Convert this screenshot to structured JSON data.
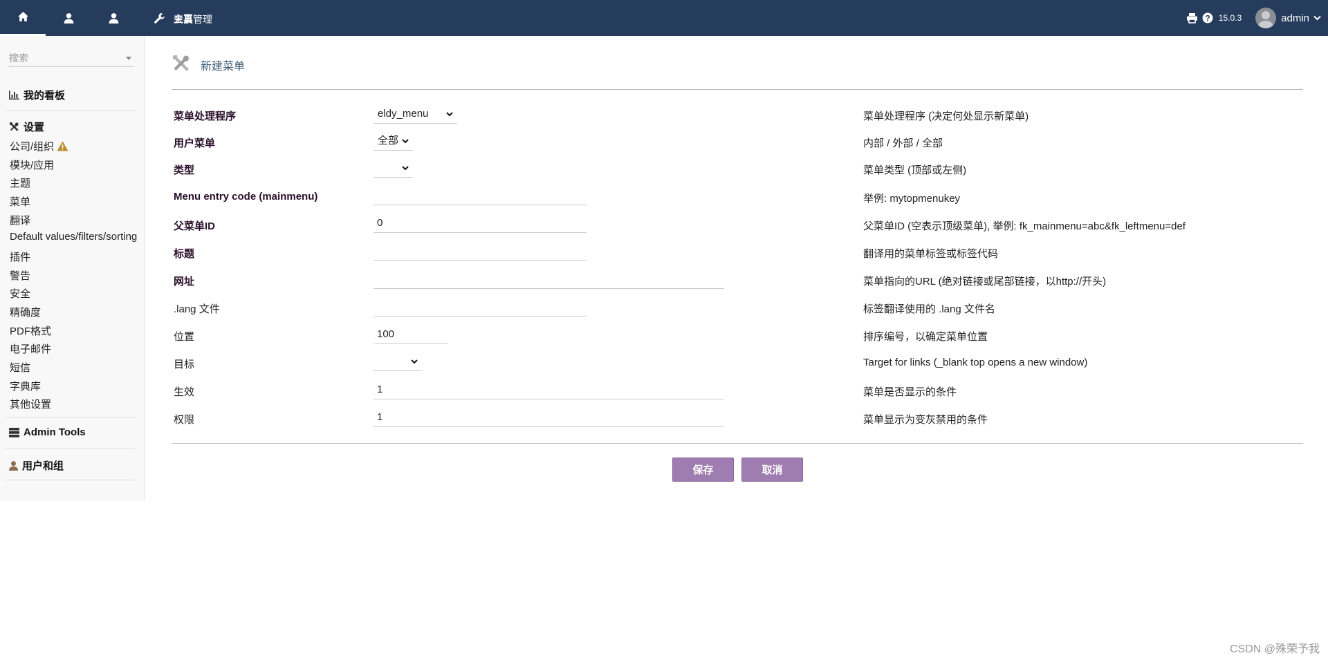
{
  "topnav": {
    "items": [
      {
        "label": "主页",
        "icon": "home-icon"
      },
      {
        "label": "会员",
        "icon": "user-icon"
      },
      {
        "label": "人事管理",
        "icon": "user-icon"
      },
      {
        "label": "工具",
        "icon": "wrench-icon"
      }
    ],
    "version": "15.0.3",
    "username": "admin"
  },
  "sidebar": {
    "search_placeholder": "搜索",
    "dashboard": "我的看板",
    "setup": "设置",
    "items": [
      "公司/组织",
      "模块/应用",
      "主题",
      "菜单",
      "翻译",
      "Default values/filters/sorting",
      "插件",
      "警告",
      "安全",
      "精确度",
      "PDF格式",
      "电子邮件",
      "短信",
      "字典库",
      "其他设置"
    ],
    "admin_tools": "Admin Tools",
    "users_groups": "用户和组"
  },
  "page": {
    "title": "新建菜单"
  },
  "form": {
    "rows": [
      {
        "label": "菜单处理程序",
        "value": "eldy_menu",
        "help": "菜单处理程序 (决定何处显示新菜单)"
      },
      {
        "label": "用户菜单",
        "value": "全部",
        "help": "内部 / 外部 / 全部"
      },
      {
        "label": "类型",
        "value": "",
        "help": "菜单类型 (顶部或左侧)"
      },
      {
        "label": "Menu entry code (mainmenu)",
        "value": "",
        "help": "举例: mytopmenukey"
      },
      {
        "label": "父菜单ID",
        "value": "0",
        "help": "父菜单ID (空表示顶级菜单), 举例: fk_mainmenu=abc&fk_leftmenu=def"
      },
      {
        "label": "标题",
        "value": "",
        "help": "翻译用的菜单标签或标签代码"
      },
      {
        "label": "网址",
        "value": "",
        "help": "菜单指向的URL (绝对链接或尾部链接，以http://开头)"
      },
      {
        "label": ".lang 文件",
        "value": "",
        "help": "标签翻译使用的 .lang 文件名"
      },
      {
        "label": "位置",
        "value": "100",
        "help": "排序编号，以确定菜单位置"
      },
      {
        "label": "目标",
        "value": "",
        "help": "Target for links (_blank top opens a new window)"
      },
      {
        "label": "生效",
        "value": "1",
        "help": "菜单是否显示的条件"
      },
      {
        "label": "权限",
        "value": "1",
        "help": "菜单显示为变灰禁用的条件"
      }
    ]
  },
  "buttons": {
    "save": "保存",
    "cancel": "取消"
  },
  "watermark": "CSDN @殊荣予我",
  "colors": {
    "topbar": "#263c5c",
    "button": "#a07db0",
    "title": "#3b5b74"
  }
}
